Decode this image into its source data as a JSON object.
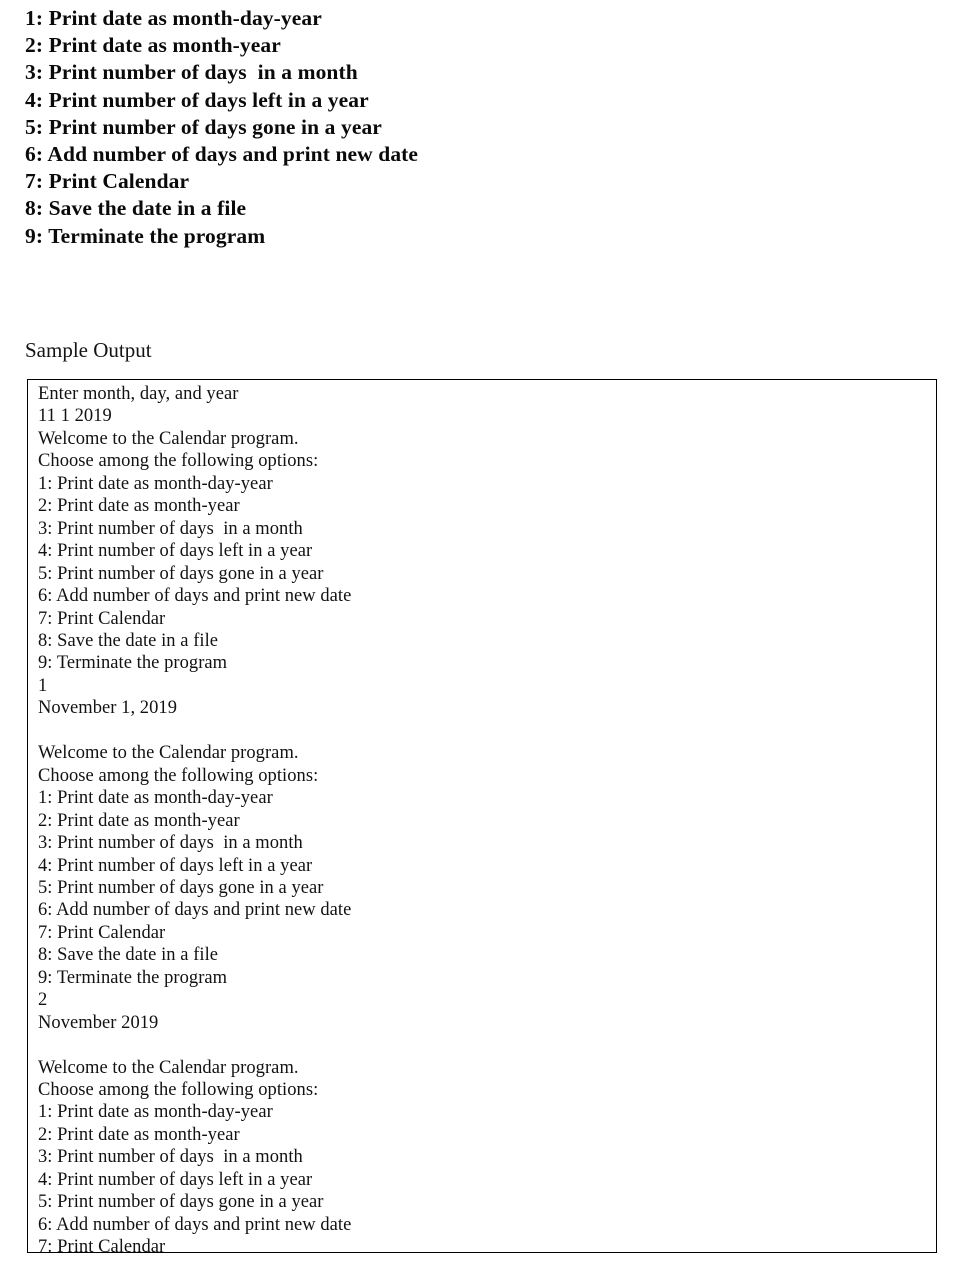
{
  "menu": {
    "items": [
      "1: Print date as month-day-year",
      "2: Print date as month-year",
      "3: Print number of days  in a month",
      "4: Print number of days left in a year",
      "5: Print number of days gone in a year",
      "6: Add number of days and print new date",
      "7: Print Calendar",
      "8: Save the date in a file",
      "9: Terminate the program"
    ]
  },
  "sample_output": {
    "heading": "Sample Output",
    "console_lines": [
      "Enter month, day, and year",
      "11 1 2019",
      "Welcome to the Calendar program.",
      "Choose among the following options:",
      "1: Print date as month-day-year",
      "2: Print date as month-year",
      "3: Print number of days  in a month",
      "4: Print number of days left in a year",
      "5: Print number of days gone in a year",
      "6: Add number of days and print new date",
      "7: Print Calendar",
      "8: Save the date in a file",
      "9: Terminate the program",
      "1",
      "November 1, 2019",
      "",
      "Welcome to the Calendar program.",
      "Choose among the following options:",
      "1: Print date as month-day-year",
      "2: Print date as month-year",
      "3: Print number of days  in a month",
      "4: Print number of days left in a year",
      "5: Print number of days gone in a year",
      "6: Add number of days and print new date",
      "7: Print Calendar",
      "8: Save the date in a file",
      "9: Terminate the program",
      "2",
      "November 2019",
      "",
      "Welcome to the Calendar program.",
      "Choose among the following options:",
      "1: Print date as month-day-year",
      "2: Print date as month-year",
      "3: Print number of days  in a month",
      "4: Print number of days left in a year",
      "5: Print number of days gone in a year",
      "6: Add number of days and print new date",
      "7: Print Calendar"
    ]
  },
  "colors": {
    "page_background": "#ffffff",
    "text": "#101010",
    "box_border": "#000000"
  }
}
